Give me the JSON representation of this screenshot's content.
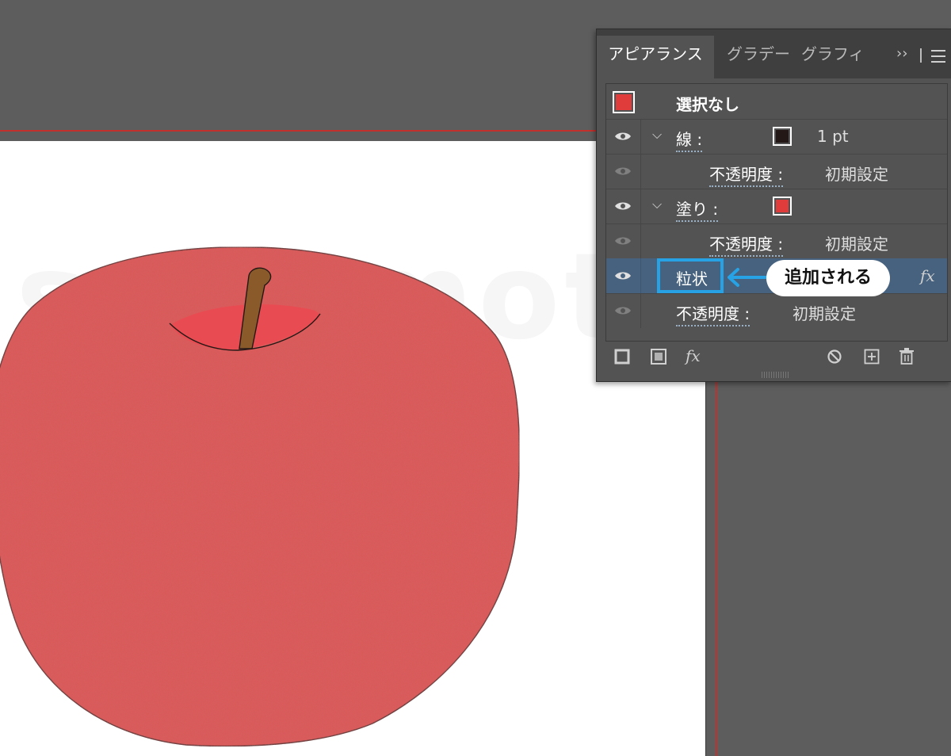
{
  "panel": {
    "tabs": [
      {
        "label": "アピアランス",
        "active": true
      },
      {
        "label": "グラデー",
        "active": false
      },
      {
        "label": "グラフィ",
        "active": false
      }
    ],
    "more_label": "››",
    "selection": {
      "label": "選択なし",
      "swatch_color": "#e03c3c"
    },
    "rows": {
      "stroke": {
        "label": "線 :",
        "value": "1 pt",
        "swatch_color": "#231815"
      },
      "stroke_opacity": {
        "label": "不透明度 :",
        "value": "初期設定"
      },
      "fill": {
        "label": "塗り :",
        "swatch_color": "#e03c3c"
      },
      "fill_opacity": {
        "label": "不透明度 :",
        "value": "初期設定"
      },
      "effect": {
        "label": "粒状",
        "fx": "fx"
      },
      "object_opacity": {
        "label": "不透明度 :",
        "value": "初期設定"
      }
    },
    "bottom_icons": [
      "new-stroke-icon",
      "new-fill-icon",
      "fx-menu-icon",
      "clear-appearance-icon",
      "duplicate-item-icon",
      "trash-icon"
    ],
    "fx_label": "fx"
  },
  "annotation": {
    "callout": "追加される",
    "highlight_color": "#27a2e4"
  },
  "canvas": {
    "watermark": "sakumoto",
    "apple_color": "#e05555",
    "stem_color": "#8b5a2b",
    "guide_color": "#c4302b"
  }
}
